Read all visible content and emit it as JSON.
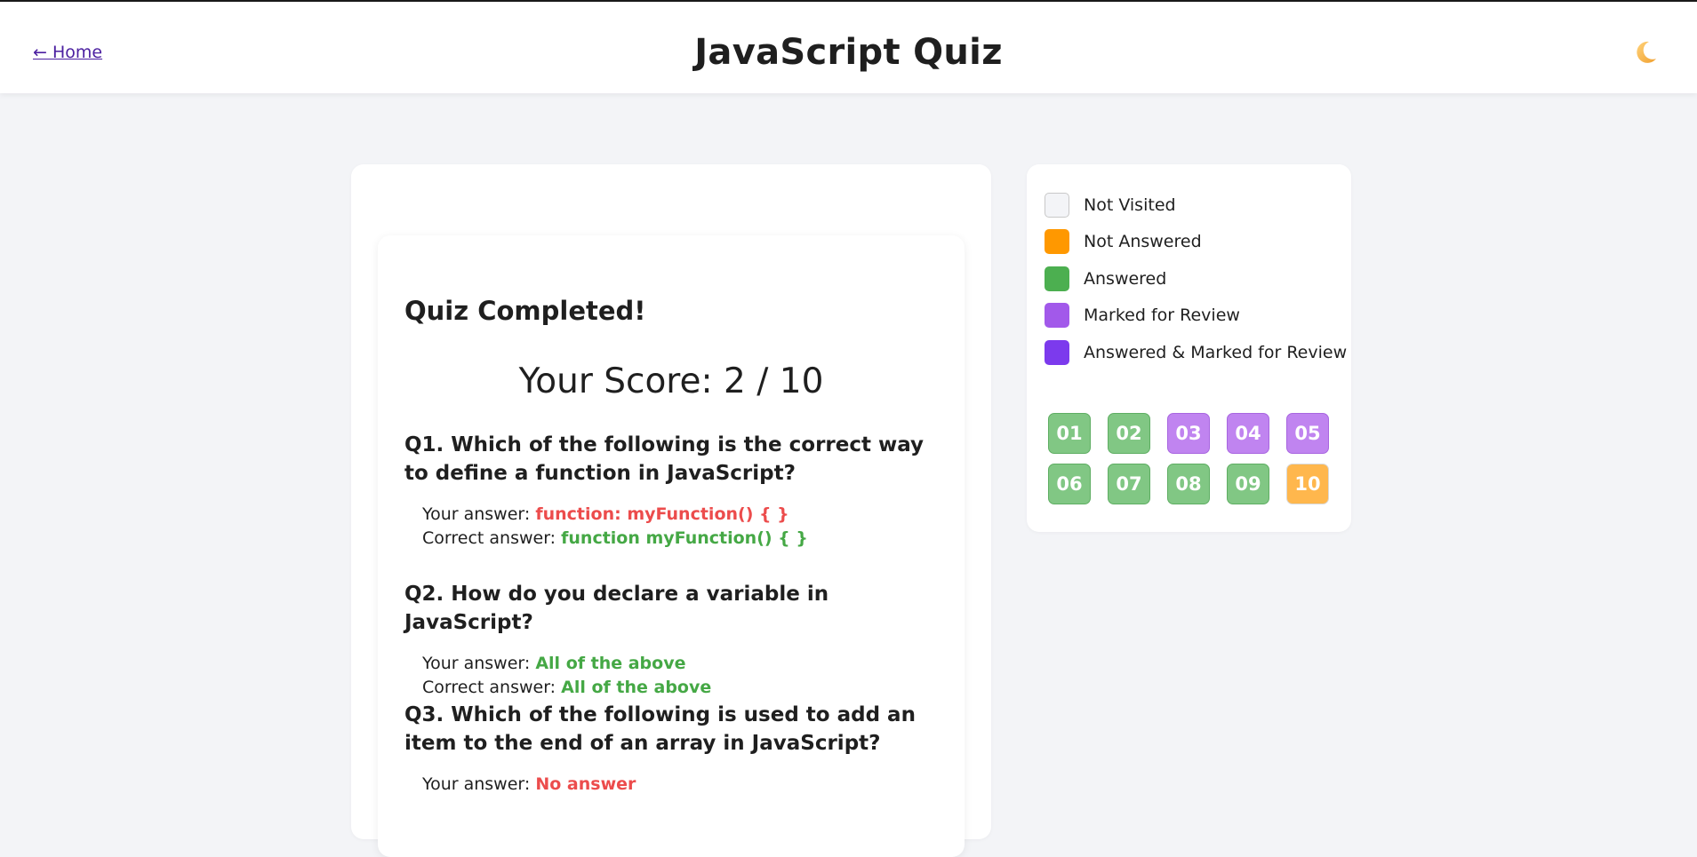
{
  "header": {
    "home_label": "← Home",
    "title": "JavaScript Quiz",
    "theme_icon": "moon-icon"
  },
  "result": {
    "heading": "Quiz Completed!",
    "score_text": "Your Score: 2 / 10",
    "your_answer_label": "Your answer: ",
    "correct_answer_label": "Correct answer: ",
    "questions": [
      {
        "text": "Q1. Which of the following is the correct way to define a function in JavaScript?",
        "your_answer": "function: myFunction() { }",
        "correct_answer": "function myFunction() { }",
        "correct": false
      },
      {
        "text": "Q2. How do you declare a variable in JavaScript?",
        "your_answer": "All of the above",
        "correct_answer": "All of the above",
        "correct": true
      },
      {
        "text": "Q3. Which of the following is used to add an item to the end of an array in JavaScript?",
        "your_answer": "No answer",
        "correct": false
      }
    ]
  },
  "legend": [
    {
      "label": "Not Visited",
      "color": "#f3f4f7"
    },
    {
      "label": "Not Answered",
      "color": "#ff9800"
    },
    {
      "label": "Answered",
      "color": "#4caf50"
    },
    {
      "label": "Marked for Review",
      "color": "#a259ea"
    },
    {
      "label": "Answered & Marked for Review",
      "color": "#7c3aed"
    }
  ],
  "question_nav": [
    {
      "label": "01",
      "status": "answered",
      "color": "#81c784"
    },
    {
      "label": "02",
      "status": "answered",
      "color": "#81c784"
    },
    {
      "label": "03",
      "status": "marked",
      "color": "#c084f0"
    },
    {
      "label": "04",
      "status": "marked",
      "color": "#c084f0"
    },
    {
      "label": "05",
      "status": "marked",
      "color": "#c084f0"
    },
    {
      "label": "06",
      "status": "answered",
      "color": "#81c784"
    },
    {
      "label": "07",
      "status": "answered",
      "color": "#81c784"
    },
    {
      "label": "08",
      "status": "answered",
      "color": "#81c784"
    },
    {
      "label": "09",
      "status": "answered",
      "color": "#81c784"
    },
    {
      "label": "10",
      "status": "not-answered",
      "color": "#ffb74d"
    }
  ]
}
